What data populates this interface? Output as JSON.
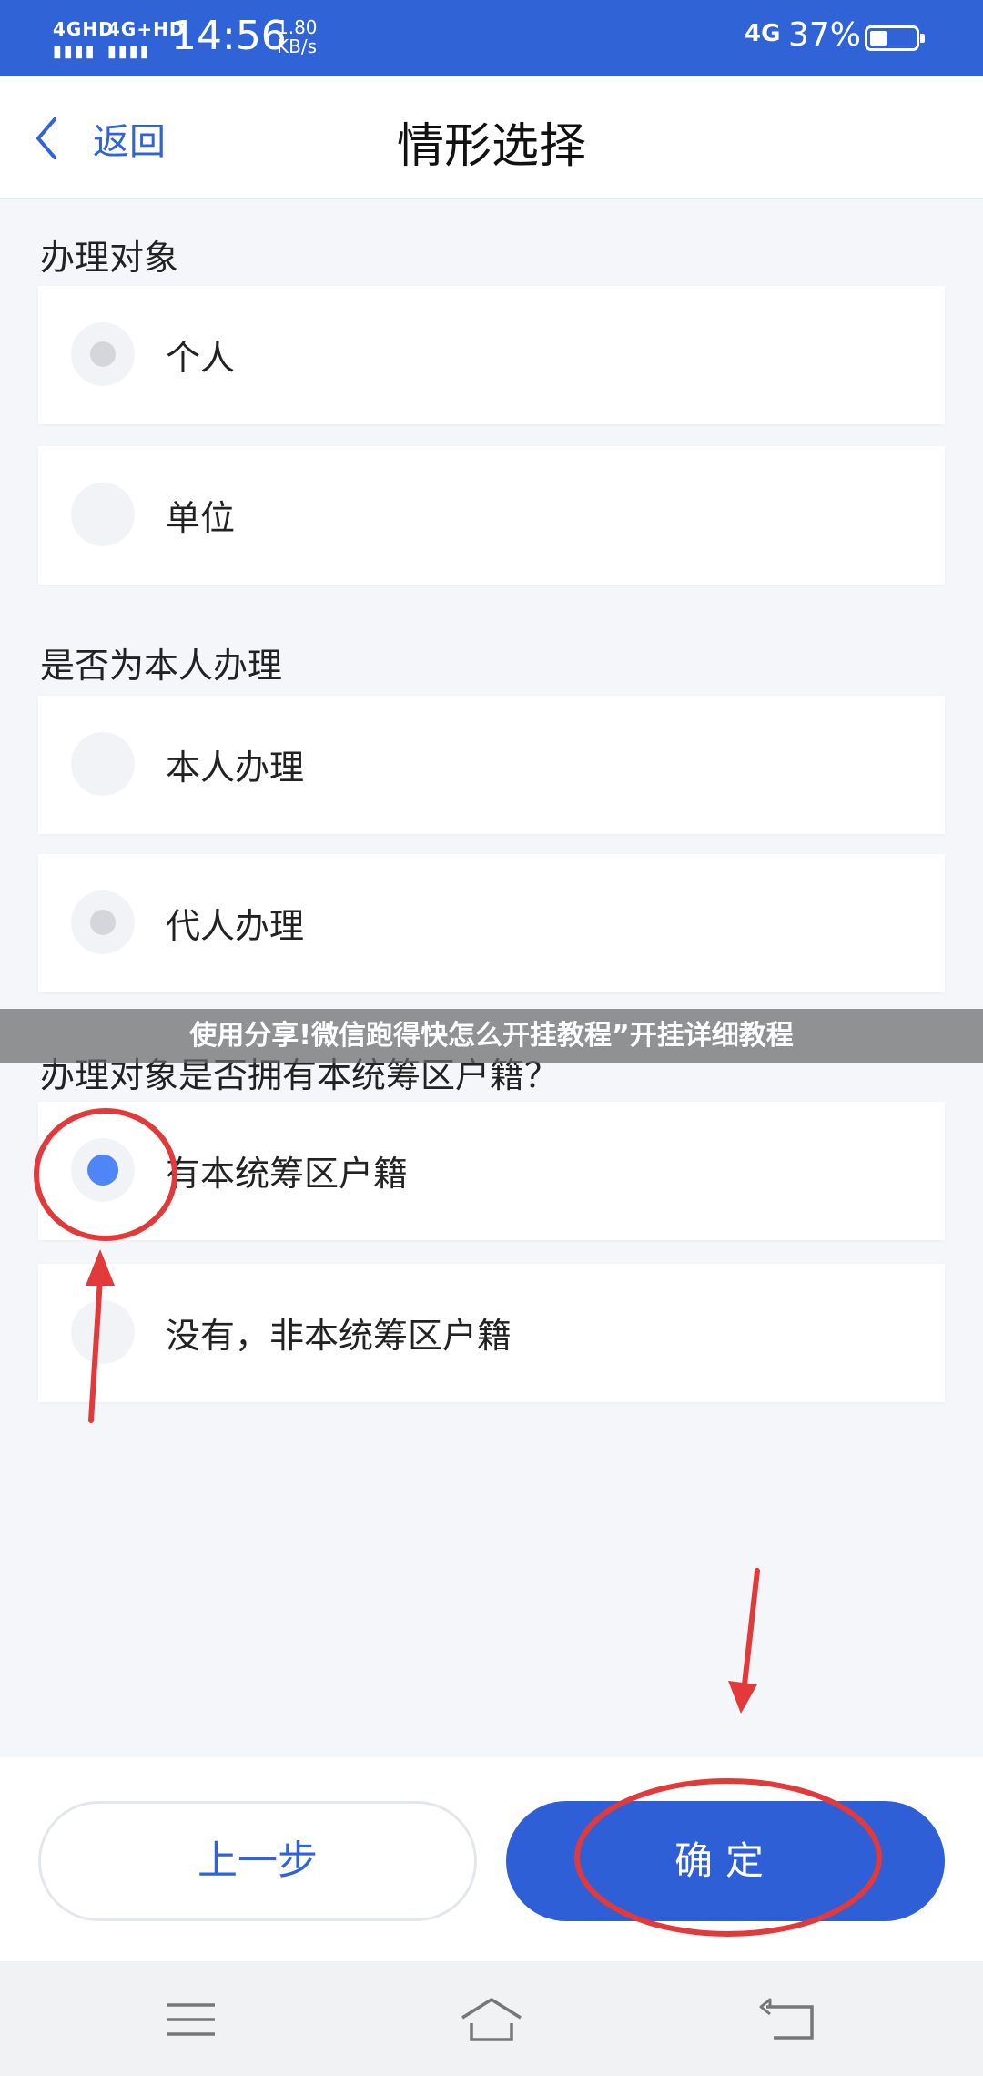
{
  "status_bar": {
    "network1": "4GHD",
    "network2": "4G+HD",
    "time": "14:56",
    "speed_value": "1.80",
    "speed_unit": "KB/s",
    "network_right": "4G",
    "battery_pct": "37%",
    "battery_level": 0.37
  },
  "nav": {
    "back_label": "返回",
    "title": "情形选择"
  },
  "sections": [
    {
      "title": "办理对象",
      "options": [
        {
          "label": "个人",
          "state": "grey"
        },
        {
          "label": "单位",
          "state": "none"
        }
      ]
    },
    {
      "title": "是否为本人办理",
      "options": [
        {
          "label": "本人办理",
          "state": "none"
        },
        {
          "label": "代人办理",
          "state": "grey"
        }
      ]
    },
    {
      "title": "办理对象是否拥有本统筹区户籍？",
      "options": [
        {
          "label": "有本统筹区户籍",
          "state": "selected"
        },
        {
          "label": "没有，非本统筹区户籍",
          "state": "none"
        }
      ]
    }
  ],
  "watermark": "使用分享!微信跑得快怎么开挂教程”开挂详细教程",
  "actions": {
    "prev_label": "上一步",
    "ok_label": "确定"
  },
  "colors": {
    "primary": "#2f63d6",
    "selected_dot": "#4f86f7",
    "annotation": "#e23a3a"
  },
  "icons": [
    "chevron-left-icon",
    "menu-icon",
    "home-icon",
    "back-icon"
  ]
}
